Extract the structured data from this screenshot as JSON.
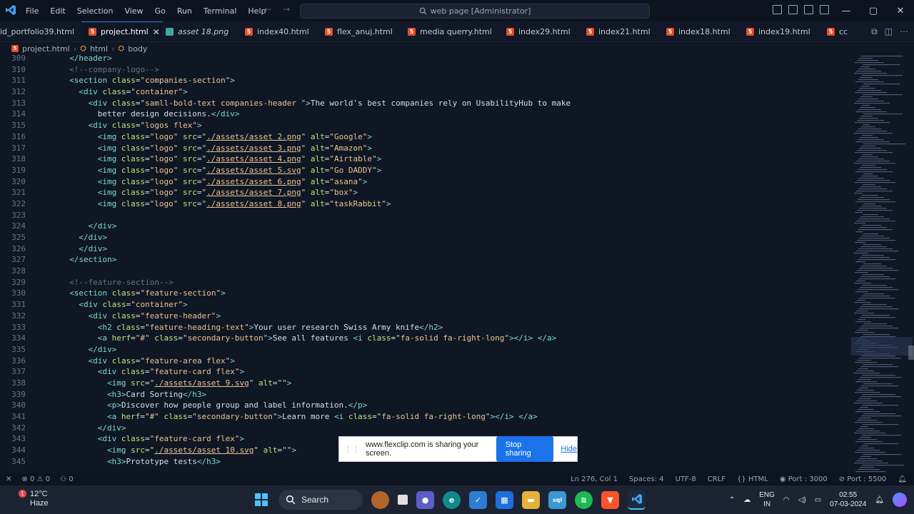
{
  "titlebar": {
    "menu": [
      "File",
      "Edit",
      "Selection",
      "View",
      "Go",
      "Run",
      "Terminal",
      "Help"
    ],
    "search_text": "web page [Administrator]"
  },
  "tabs": [
    {
      "label": "id_portfolio39.html",
      "type": "html",
      "active": false
    },
    {
      "label": "project.html",
      "type": "html",
      "active": true
    },
    {
      "label": "asset 18.png",
      "type": "image",
      "active": false
    },
    {
      "label": "index40.html",
      "type": "html",
      "active": false
    },
    {
      "label": "flex_anuj.html",
      "type": "html",
      "active": false
    },
    {
      "label": "media querry.html",
      "type": "html",
      "active": false
    },
    {
      "label": "index29.html",
      "type": "html",
      "active": false
    },
    {
      "label": "index21.html",
      "type": "html",
      "active": false
    },
    {
      "label": "index18.html",
      "type": "html",
      "active": false
    },
    {
      "label": "index19.html",
      "type": "html",
      "active": false
    },
    {
      "label": "cc",
      "type": "html",
      "active": false
    }
  ],
  "breadcrumb": [
    "project.html",
    "html",
    "body"
  ],
  "code_lines": [
    {
      "n": "309",
      "indent": 2,
      "s": [
        [
          "tag",
          "</header>"
        ]
      ]
    },
    {
      "n": "310",
      "indent": 2,
      "s": [
        [
          "com",
          "<!--company-logo-->"
        ]
      ]
    },
    {
      "n": "311",
      "indent": 2,
      "s": [
        [
          "tag",
          "<section "
        ],
        [
          "attr",
          "class"
        ],
        [
          "txt",
          "="
        ],
        [
          "str",
          "\"companies-section\""
        ],
        [
          "tag",
          ">"
        ]
      ]
    },
    {
      "n": "312",
      "indent": 4,
      "s": [
        [
          "tag",
          "<div "
        ],
        [
          "attr",
          "class"
        ],
        [
          "txt",
          "="
        ],
        [
          "str",
          "\"container\""
        ],
        [
          "tag",
          ">"
        ]
      ]
    },
    {
      "n": "313",
      "indent": 6,
      "s": [
        [
          "tag",
          "<div "
        ],
        [
          "attr",
          "class"
        ],
        [
          "txt",
          "="
        ],
        [
          "str",
          "\"samll-bold-text companies-header \""
        ],
        [
          "tag",
          ">"
        ],
        [
          "txt",
          "The world's best companies rely on UsabilityHub to make"
        ]
      ]
    },
    {
      "n": "314",
      "indent": 8,
      "s": [
        [
          "txt",
          "better design decisions."
        ],
        [
          "tag",
          "</div>"
        ]
      ]
    },
    {
      "n": "315",
      "indent": 6,
      "s": [
        [
          "tag",
          "<div "
        ],
        [
          "attr",
          "class"
        ],
        [
          "txt",
          "="
        ],
        [
          "str",
          "\"logos flex\""
        ],
        [
          "tag",
          ">"
        ]
      ]
    },
    {
      "n": "316",
      "indent": 8,
      "s": [
        [
          "tag",
          "<img "
        ],
        [
          "attr",
          "class"
        ],
        [
          "txt",
          "="
        ],
        [
          "str",
          "\"logo\" "
        ],
        [
          "attr",
          "src"
        ],
        [
          "txt",
          "="
        ],
        [
          "str",
          "\""
        ],
        [
          "stru",
          "./assets/asset 2.png"
        ],
        [
          "str",
          "\" "
        ],
        [
          "attr",
          "alt"
        ],
        [
          "txt",
          "="
        ],
        [
          "str",
          "\"Google\""
        ],
        [
          "tag",
          ">"
        ]
      ]
    },
    {
      "n": "317",
      "indent": 8,
      "s": [
        [
          "tag",
          "<img "
        ],
        [
          "attr",
          "class"
        ],
        [
          "txt",
          "="
        ],
        [
          "str",
          "\"logo\" "
        ],
        [
          "attr",
          "src"
        ],
        [
          "txt",
          "="
        ],
        [
          "str",
          "\""
        ],
        [
          "stru",
          "./assets/asset 3.png"
        ],
        [
          "str",
          "\" "
        ],
        [
          "attr",
          "alt"
        ],
        [
          "txt",
          "="
        ],
        [
          "str",
          "\"Amazon\""
        ],
        [
          "tag",
          ">"
        ]
      ]
    },
    {
      "n": "318",
      "indent": 8,
      "s": [
        [
          "tag",
          "<img "
        ],
        [
          "attr",
          "class"
        ],
        [
          "txt",
          "="
        ],
        [
          "str",
          "\"logo\" "
        ],
        [
          "attr",
          "src"
        ],
        [
          "txt",
          "="
        ],
        [
          "str",
          "\""
        ],
        [
          "stru",
          "./assets/asset 4.png"
        ],
        [
          "str",
          "\" "
        ],
        [
          "attr",
          "alt"
        ],
        [
          "txt",
          "="
        ],
        [
          "str",
          "\"Airtable\""
        ],
        [
          "tag",
          ">"
        ]
      ]
    },
    {
      "n": "319",
      "indent": 8,
      "s": [
        [
          "tag",
          "<img "
        ],
        [
          "attr",
          "class"
        ],
        [
          "txt",
          "="
        ],
        [
          "str",
          "\"logo\" "
        ],
        [
          "attr",
          "src"
        ],
        [
          "txt",
          "="
        ],
        [
          "str",
          "\""
        ],
        [
          "stru",
          "./assets/asset 5.svg"
        ],
        [
          "str",
          "\" "
        ],
        [
          "attr",
          "alt"
        ],
        [
          "txt",
          "="
        ],
        [
          "str",
          "\"Go DADDY\""
        ],
        [
          "tag",
          ">"
        ]
      ]
    },
    {
      "n": "320",
      "indent": 8,
      "s": [
        [
          "tag",
          "<img "
        ],
        [
          "attr",
          "class"
        ],
        [
          "txt",
          "="
        ],
        [
          "str",
          "\"logo\" "
        ],
        [
          "attr",
          "src"
        ],
        [
          "txt",
          "="
        ],
        [
          "str",
          "\""
        ],
        [
          "stru",
          "./assets/asset 6.png"
        ],
        [
          "str",
          "\" "
        ],
        [
          "attr",
          "alt"
        ],
        [
          "txt",
          "="
        ],
        [
          "str",
          "\"asana\""
        ],
        [
          "tag",
          ">"
        ]
      ]
    },
    {
      "n": "321",
      "indent": 8,
      "s": [
        [
          "tag",
          "<img "
        ],
        [
          "attr",
          "class"
        ],
        [
          "txt",
          "="
        ],
        [
          "str",
          "\"logo\" "
        ],
        [
          "attr",
          "src"
        ],
        [
          "txt",
          "="
        ],
        [
          "str",
          "\""
        ],
        [
          "stru",
          "./assets/asset 7.png"
        ],
        [
          "str",
          "\" "
        ],
        [
          "attr",
          "alt"
        ],
        [
          "txt",
          "="
        ],
        [
          "str",
          "\"box\""
        ],
        [
          "tag",
          ">"
        ]
      ]
    },
    {
      "n": "322",
      "indent": 8,
      "s": [
        [
          "tag",
          "<img "
        ],
        [
          "attr",
          "class"
        ],
        [
          "txt",
          "="
        ],
        [
          "str",
          "\"logo\" "
        ],
        [
          "attr",
          "src"
        ],
        [
          "txt",
          "="
        ],
        [
          "str",
          "\""
        ],
        [
          "stru",
          "./assets/asset 8.png"
        ],
        [
          "str",
          "\" "
        ],
        [
          "attr",
          "alt"
        ],
        [
          "txt",
          "="
        ],
        [
          "str",
          "\"taskRabbit\""
        ],
        [
          "tag",
          ">"
        ]
      ]
    },
    {
      "n": "323",
      "indent": 0,
      "s": []
    },
    {
      "n": "324",
      "indent": 6,
      "s": [
        [
          "tag",
          "</div>"
        ]
      ]
    },
    {
      "n": "325",
      "indent": 4,
      "s": [
        [
          "tag",
          "</div>"
        ]
      ]
    },
    {
      "n": "326",
      "indent": 4,
      "s": [
        [
          "tag",
          "</div>"
        ]
      ]
    },
    {
      "n": "327",
      "indent": 2,
      "s": [
        [
          "tag",
          "</section>"
        ]
      ]
    },
    {
      "n": "328",
      "indent": 0,
      "s": []
    },
    {
      "n": "329",
      "indent": 2,
      "s": [
        [
          "com",
          "<!--feature-section-->"
        ]
      ]
    },
    {
      "n": "330",
      "indent": 2,
      "s": [
        [
          "tag",
          "<section "
        ],
        [
          "attr",
          "class"
        ],
        [
          "txt",
          "="
        ],
        [
          "str",
          "\"feature-section\""
        ],
        [
          "tag",
          ">"
        ]
      ]
    },
    {
      "n": "331",
      "indent": 4,
      "s": [
        [
          "tag",
          "<div "
        ],
        [
          "attr",
          "class"
        ],
        [
          "txt",
          "="
        ],
        [
          "str",
          "\"container\""
        ],
        [
          "tag",
          ">"
        ]
      ]
    },
    {
      "n": "332",
      "indent": 6,
      "s": [
        [
          "tag",
          "<div "
        ],
        [
          "attr",
          "class"
        ],
        [
          "txt",
          "="
        ],
        [
          "str",
          "\"feature-header\""
        ],
        [
          "tag",
          ">"
        ]
      ]
    },
    {
      "n": "333",
      "indent": 8,
      "s": [
        [
          "tag",
          "<h2 "
        ],
        [
          "attr",
          "class"
        ],
        [
          "txt",
          "="
        ],
        [
          "str",
          "\"feature-heading-text\""
        ],
        [
          "tag",
          ">"
        ],
        [
          "txt",
          "Your user research Swiss Army knife"
        ],
        [
          "tag",
          "</h2>"
        ]
      ]
    },
    {
      "n": "334",
      "indent": 8,
      "s": [
        [
          "tag",
          "<a "
        ],
        [
          "attr",
          "herf"
        ],
        [
          "txt",
          "="
        ],
        [
          "str",
          "\"#\" "
        ],
        [
          "attr",
          "class"
        ],
        [
          "txt",
          "="
        ],
        [
          "str",
          "\"secondary-button\""
        ],
        [
          "tag",
          ">"
        ],
        [
          "txt",
          "See all features "
        ],
        [
          "tag",
          "<i "
        ],
        [
          "attr",
          "class"
        ],
        [
          "txt",
          "="
        ],
        [
          "str",
          "\"fa-solid fa-right-long\""
        ],
        [
          "tag",
          "></i> </a>"
        ]
      ]
    },
    {
      "n": "335",
      "indent": 6,
      "s": [
        [
          "tag",
          "</div>"
        ]
      ]
    },
    {
      "n": "336",
      "indent": 6,
      "s": [
        [
          "tag",
          "<div "
        ],
        [
          "attr",
          "class"
        ],
        [
          "txt",
          "="
        ],
        [
          "str",
          "\"feature-area flex\""
        ],
        [
          "tag",
          ">"
        ]
      ]
    },
    {
      "n": "337",
      "indent": 8,
      "s": [
        [
          "tag",
          "<div "
        ],
        [
          "attr",
          "class"
        ],
        [
          "txt",
          "="
        ],
        [
          "str",
          "\"feature-card flex\""
        ],
        [
          "tag",
          ">"
        ]
      ]
    },
    {
      "n": "338",
      "indent": 10,
      "s": [
        [
          "tag",
          "<img "
        ],
        [
          "attr",
          "src"
        ],
        [
          "txt",
          "="
        ],
        [
          "str",
          "\""
        ],
        [
          "stru",
          "./assets/asset 9.svg"
        ],
        [
          "str",
          "\" "
        ],
        [
          "attr",
          "alt"
        ],
        [
          "txt",
          "="
        ],
        [
          "str",
          "\"\""
        ],
        [
          "tag",
          ">"
        ]
      ]
    },
    {
      "n": "339",
      "indent": 10,
      "s": [
        [
          "tag",
          "<h3>"
        ],
        [
          "txt",
          "Card Sorting"
        ],
        [
          "tag",
          "</h3>"
        ]
      ]
    },
    {
      "n": "340",
      "indent": 10,
      "s": [
        [
          "tag",
          "<p>"
        ],
        [
          "txt",
          "Discover how people group and label information."
        ],
        [
          "tag",
          "</p>"
        ]
      ]
    },
    {
      "n": "341",
      "indent": 10,
      "s": [
        [
          "tag",
          "<a "
        ],
        [
          "attr",
          "herf"
        ],
        [
          "txt",
          "="
        ],
        [
          "str",
          "\"#\" "
        ],
        [
          "attr",
          "class"
        ],
        [
          "txt",
          "="
        ],
        [
          "str",
          "\"secondary-button\""
        ],
        [
          "tag",
          ">"
        ],
        [
          "txt",
          "Learn more "
        ],
        [
          "tag",
          "<i "
        ],
        [
          "attr",
          "class"
        ],
        [
          "txt",
          "="
        ],
        [
          "str",
          "\"fa-solid fa-right-long\""
        ],
        [
          "tag",
          "></i> </a>"
        ]
      ]
    },
    {
      "n": "342",
      "indent": 8,
      "s": [
        [
          "tag",
          "</div>"
        ]
      ]
    },
    {
      "n": "343",
      "indent": 8,
      "s": [
        [
          "tag",
          "<div "
        ],
        [
          "attr",
          "class"
        ],
        [
          "txt",
          "="
        ],
        [
          "str",
          "\"feature-card flex\""
        ],
        [
          "tag",
          ">"
        ]
      ]
    },
    {
      "n": "344",
      "indent": 10,
      "s": [
        [
          "tag",
          "<img "
        ],
        [
          "attr",
          "src"
        ],
        [
          "txt",
          "="
        ],
        [
          "str",
          "\""
        ],
        [
          "stru",
          "./assets/asset 10.svg"
        ],
        [
          "str",
          "\" "
        ],
        [
          "attr",
          "alt"
        ],
        [
          "txt",
          "="
        ],
        [
          "str",
          "\"\""
        ],
        [
          "tag",
          ">"
        ]
      ]
    },
    {
      "n": "345",
      "indent": 10,
      "s": [
        [
          "tag",
          "<h3>"
        ],
        [
          "txt",
          "Prototype tests"
        ],
        [
          "tag",
          "</h3>"
        ]
      ]
    }
  ],
  "statusbar": {
    "problems_errors": "0",
    "problems_warnings": "0",
    "ports": "0",
    "position": "Ln 276, Col 1",
    "spaces": "Spaces: 4",
    "encoding": "UTF-8",
    "eol": "CRLF",
    "language": "HTML",
    "port": "Port : 3000",
    "port2": "Port : 5500"
  },
  "share_bar": {
    "message": "www.flexclip.com is sharing your screen.",
    "stop_label": "Stop sharing",
    "hide_label": "Hide"
  },
  "taskbar": {
    "weather_temp": "12°C",
    "weather_desc": "Haze",
    "notification_count": "1",
    "search_label": "Search",
    "lang1": "ENG",
    "lang2": "IN",
    "time": "02:55",
    "date": "07-03-2024"
  },
  "colors": {
    "editor_bg": "#0f1624",
    "tag": "#7fdbca",
    "attr": "#c5e478",
    "string": "#ecc48d",
    "comment": "#637777",
    "accent": "#1a73e8"
  }
}
